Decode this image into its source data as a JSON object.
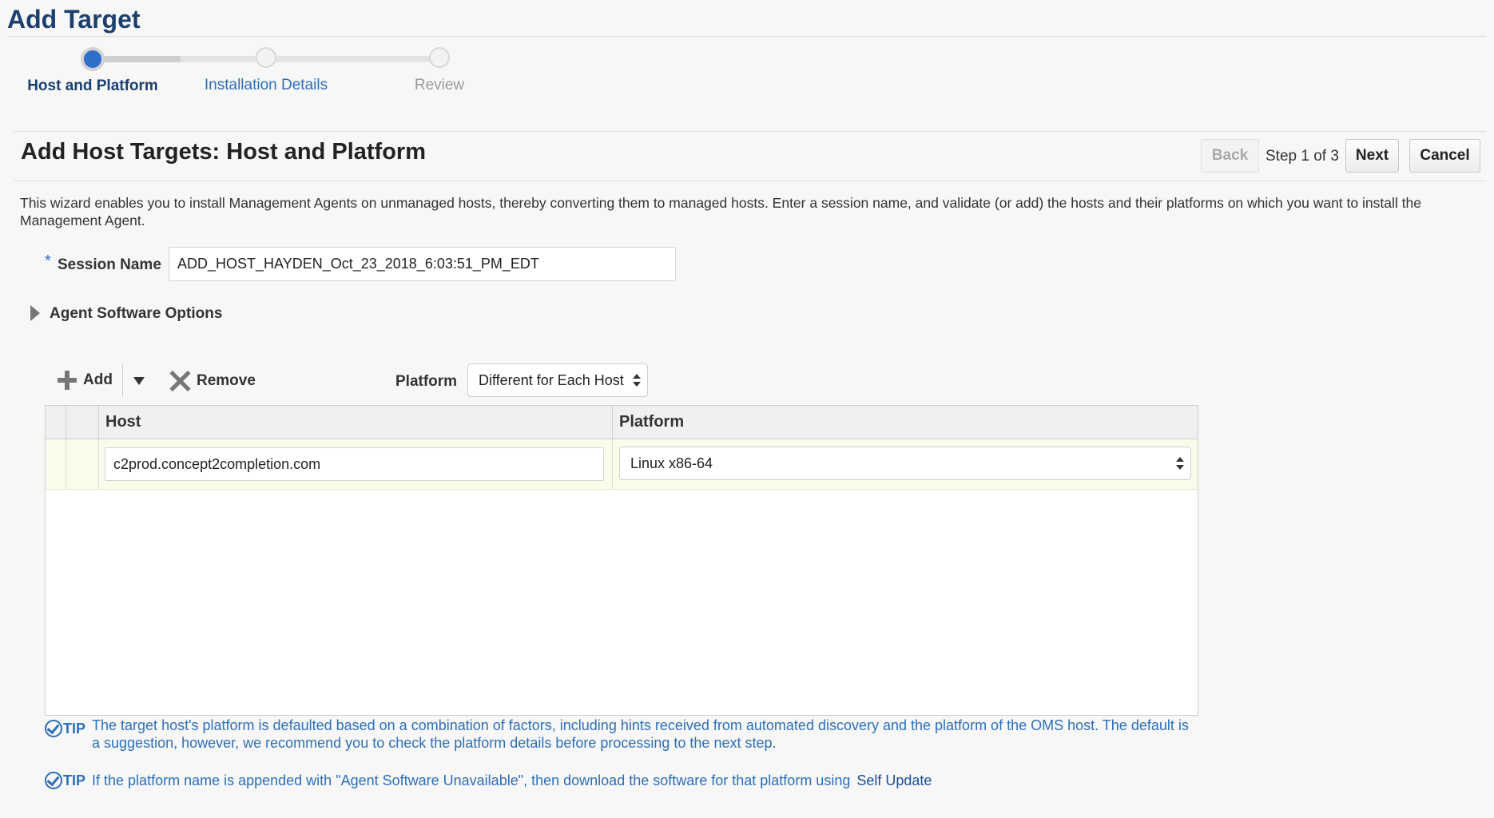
{
  "page_title": "Add Target",
  "train": {
    "steps": [
      {
        "label": "Host and Platform",
        "state": "active"
      },
      {
        "label": "Installation Details",
        "state": "link"
      },
      {
        "label": "Review",
        "state": "disabled"
      }
    ]
  },
  "section_title": "Add Host Targets: Host and Platform",
  "nav": {
    "back_label": "Back",
    "step_text": "Step 1 of 3",
    "next_label": "Next",
    "cancel_label": "Cancel"
  },
  "description": "This wizard enables you to install Management Agents on unmanaged hosts, thereby converting them to managed hosts. Enter a session name, and validate (or add) the hosts and their platforms on which you want to install the Management Agent.",
  "session": {
    "required_mark": "*",
    "label": "Session Name",
    "value": "ADD_HOST_HAYDEN_Oct_23_2018_6:03:51_PM_EDT"
  },
  "agent_options_label": "Agent Software Options",
  "toolbar": {
    "add_label": "Add",
    "remove_label": "Remove",
    "platform_label": "Platform",
    "platform_value": "Different for Each Host"
  },
  "table": {
    "columns": [
      "Host",
      "Platform"
    ],
    "rows": [
      {
        "host": "c2prod.concept2completion.com",
        "platform": "Linux x86-64"
      }
    ]
  },
  "tips": {
    "tip_label": "TIP",
    "tip1": "The target host's platform is defaulted based on a combination of factors, including hints received from automated discovery and the platform of the OMS host. The default is a suggestion, however, we recommend you to check the platform details before processing to the next step.",
    "tip2": "If the platform name is appended with \"Agent Software Unavailable\", then download the software for that platform using",
    "tip2_link": "Self Update"
  },
  "colors": {
    "title_blue": "#1c3f6e",
    "link_blue": "#2d6fb8",
    "active_step": "#2f6fc9",
    "row_highlight": "#fbfbe9"
  }
}
